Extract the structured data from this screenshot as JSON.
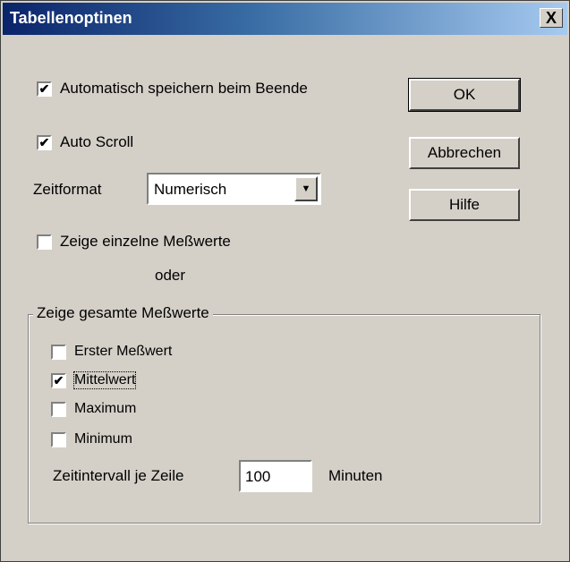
{
  "window": {
    "title": "Tabellenoptinen",
    "close_symbol": "X"
  },
  "options": {
    "autosave": {
      "label": "Automatisch speichern beim Beende",
      "checked": true
    },
    "autoscroll": {
      "label": "Auto Scroll",
      "checked": true
    },
    "time_format": {
      "label": "Zeitformat",
      "value": "Numerisch"
    },
    "single_values": {
      "label": "Zeige einzelne Meßwerte",
      "checked": false
    },
    "or_text": "oder"
  },
  "group": {
    "label": "Zeige gesamte Meßwerte",
    "items": [
      {
        "label": "Erster Meßwert",
        "checked": false
      },
      {
        "label": "Mittelwert",
        "checked": true
      },
      {
        "label": "Maximum",
        "checked": false
      },
      {
        "label": "Minimum",
        "checked": false
      }
    ],
    "interval_label": "Zeitintervall je Zeile",
    "interval_value": "100",
    "interval_unit": "Minuten"
  },
  "buttons": {
    "ok": "OK",
    "cancel": "Abbrechen",
    "help": "Hilfe"
  },
  "check_mark": "✔"
}
